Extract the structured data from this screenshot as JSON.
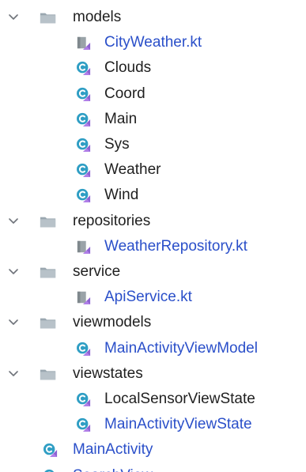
{
  "colors": {
    "text_default": "#1f1f1f",
    "text_modified": "#2a4fc9",
    "folder": "#9aa7b0",
    "class_icon": "#2f9ec4",
    "kotlin_badge": "#8e63d2",
    "kotlin_file": "#9aa3a8",
    "chevron": "#6f737a"
  },
  "tree": {
    "items": [
      {
        "label": "models",
        "type": "folder",
        "expanded": true,
        "color": "dark",
        "depth": 0
      },
      {
        "label": "CityWeather.kt",
        "type": "kotlin-file",
        "color": "blue",
        "depth": 1
      },
      {
        "label": "Clouds",
        "type": "class",
        "color": "dark",
        "depth": 1
      },
      {
        "label": "Coord",
        "type": "class",
        "color": "dark",
        "depth": 1
      },
      {
        "label": "Main",
        "type": "class",
        "color": "dark",
        "depth": 1
      },
      {
        "label": "Sys",
        "type": "class",
        "color": "dark",
        "depth": 1
      },
      {
        "label": "Weather",
        "type": "class",
        "color": "dark",
        "depth": 1
      },
      {
        "label": "Wind",
        "type": "class",
        "color": "dark",
        "depth": 1
      },
      {
        "label": "repositories",
        "type": "folder",
        "expanded": true,
        "color": "dark",
        "depth": 0
      },
      {
        "label": "WeatherRepository.kt",
        "type": "kotlin-file",
        "color": "blue",
        "depth": 1
      },
      {
        "label": "service",
        "type": "folder",
        "expanded": true,
        "color": "dark",
        "depth": 0
      },
      {
        "label": "ApiService.kt",
        "type": "kotlin-file",
        "color": "blue",
        "depth": 1
      },
      {
        "label": "viewmodels",
        "type": "folder",
        "expanded": true,
        "color": "dark",
        "depth": 0
      },
      {
        "label": "MainActivityViewModel",
        "type": "class",
        "color": "blue",
        "depth": 1
      },
      {
        "label": "viewstates",
        "type": "folder",
        "expanded": true,
        "color": "dark",
        "depth": 0
      },
      {
        "label": "LocalSensorViewState",
        "type": "class",
        "color": "dark",
        "depth": 1
      },
      {
        "label": "MainActivityViewState",
        "type": "class",
        "color": "blue",
        "depth": 1
      },
      {
        "label": "MainActivity",
        "type": "class",
        "color": "blue",
        "depth": 0
      },
      {
        "label": "SearchView",
        "type": "class",
        "color": "blue",
        "depth": 0
      }
    ]
  }
}
